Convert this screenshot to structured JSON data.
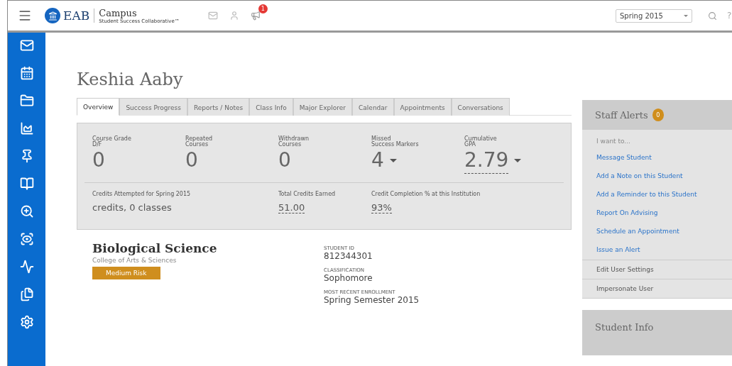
{
  "header": {
    "brand": "EAB",
    "product": "Campus",
    "tagline": "Student Success Collaborative™",
    "notification_count": "1",
    "term": "Spring 2015",
    "help": "?"
  },
  "student": {
    "name": "Keshia Aaby"
  },
  "tabs": [
    {
      "label": "Overview",
      "selected": true
    },
    {
      "label": "Success Progress",
      "selected": false
    },
    {
      "label": "Reports / Notes",
      "selected": false
    },
    {
      "label": "Class Info",
      "selected": false
    },
    {
      "label": "Major Explorer",
      "selected": false
    },
    {
      "label": "Calendar",
      "selected": false
    },
    {
      "label": "Appointments",
      "selected": false
    },
    {
      "label": "Conversations",
      "selected": false
    }
  ],
  "stats": [
    {
      "label": [
        "Course Grade",
        "D/F"
      ],
      "value": "0",
      "dropdown": false,
      "underlined": false
    },
    {
      "label": [
        "Repeated",
        "Courses"
      ],
      "value": "0",
      "dropdown": false,
      "underlined": false
    },
    {
      "label": [
        "Withdrawn",
        "Courses"
      ],
      "value": "0",
      "dropdown": false,
      "underlined": false
    },
    {
      "label": [
        "Missed",
        "Success Markers"
      ],
      "value": "4",
      "dropdown": true,
      "underlined": false
    },
    {
      "label": [
        "Cumulative",
        "GPA"
      ],
      "value": "2.79",
      "dropdown": true,
      "underlined": true
    }
  ],
  "credits": [
    {
      "label": "Credits Attempted for Spring 2015",
      "value": "credits, 0 classes",
      "underlined": false
    },
    {
      "label": "Total Credits Earned",
      "value": "51.00",
      "underlined": true
    },
    {
      "label": "Credit Completion % at this Institution",
      "value": "93%",
      "underlined": true
    }
  ],
  "major": {
    "title": "Biological Science",
    "college": "College of Arts & Sciences",
    "risk": "Medium Risk"
  },
  "details": [
    {
      "label": "STUDENT ID",
      "value": "812344301"
    },
    {
      "label": "CLASSIFICATION",
      "value": "Sophomore"
    },
    {
      "label": "MOST RECENT ENROLLMENT",
      "value": "Spring Semester 2015"
    }
  ],
  "staff_alerts": {
    "title": "Staff Alerts",
    "count": "0",
    "prompt": "I want to...",
    "actions": [
      "Message Student",
      "Add a Note on this Student",
      "Add a Reminder to this Student",
      "Report On Advising",
      "Schedule an Appointment",
      "Issue an Alert"
    ],
    "settings": [
      "Edit User Settings",
      "Impersonate User"
    ]
  },
  "student_info": {
    "title": "Student Info"
  }
}
